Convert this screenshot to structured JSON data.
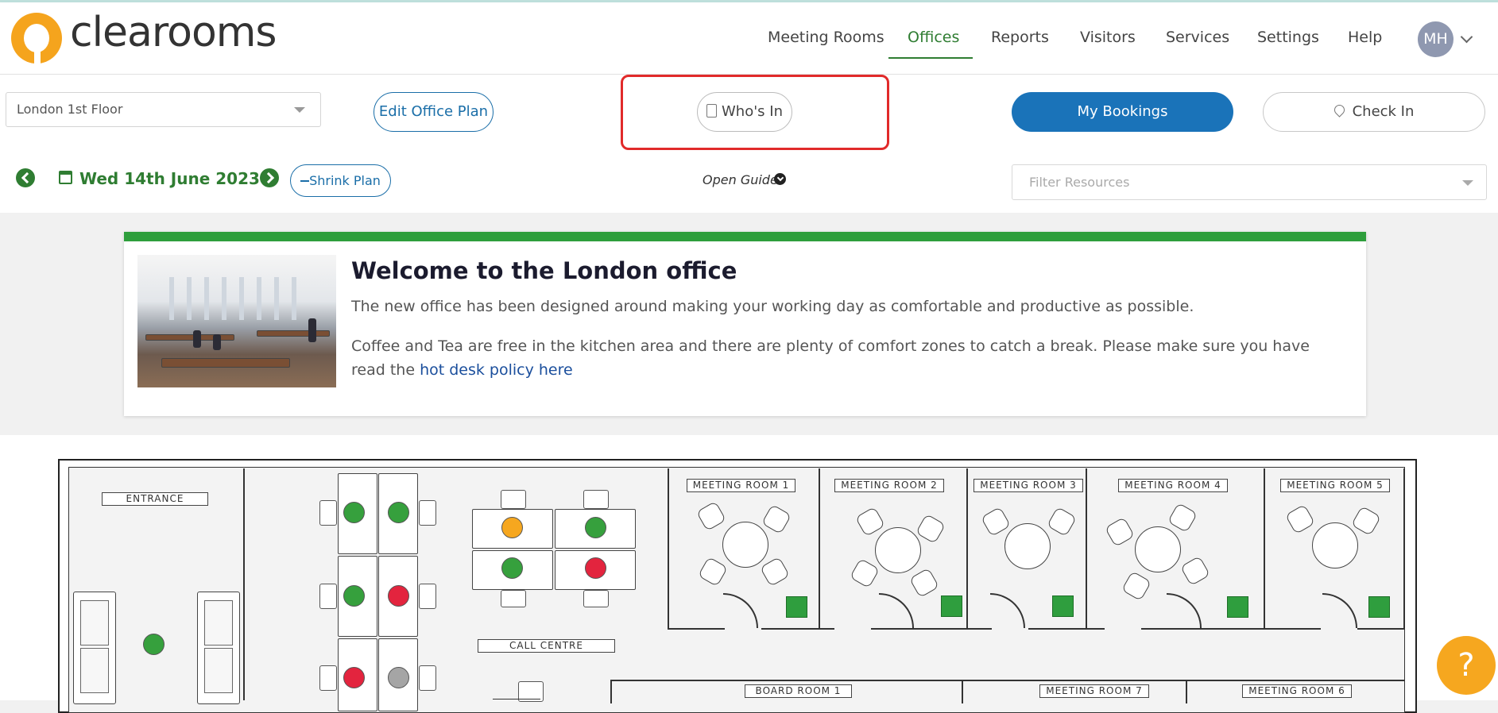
{
  "brand": {
    "name": "clearooms"
  },
  "nav": {
    "items": [
      "Meeting Rooms",
      "Offices",
      "Reports",
      "Visitors",
      "Services",
      "Settings",
      "Help"
    ],
    "active": "Offices",
    "avatar_initials": "MH"
  },
  "toolbar": {
    "location_select": "London 1st Floor",
    "edit_plan_label": "Edit Office Plan",
    "whos_in_label": "Who's In",
    "my_bookings_label": "My Bookings",
    "check_in_label": "Check In",
    "date_label": "Wed 14th June 2023",
    "shrink_plan_label": "Shrink Plan",
    "open_guide_label": "Open Guide",
    "filter_placeholder": "Filter Resources"
  },
  "welcome": {
    "title": "Welcome to the London office",
    "paragraph1": "The new office has been designed around making your working day as comfortable and productive as possible.",
    "paragraph2": "Coffee and Tea are free in the kitchen area and there are plenty of comfort zones to catch a break. Please make sure you have read the ",
    "link_text": "hot desk policy here"
  },
  "floor_plan": {
    "labels": {
      "entrance": "ENTRANCE",
      "call_centre": "CALL CENTRE",
      "board_room_1": "BOARD ROOM 1",
      "meeting_room_1": "MEETING ROOM 1",
      "meeting_room_2": "MEETING ROOM 2",
      "meeting_room_3": "MEETING ROOM 3",
      "meeting_room_4": "MEETING ROOM 4",
      "meeting_room_5": "MEETING ROOM 5",
      "meeting_room_6": "MEETING ROOM 6",
      "meeting_room_7": "MEETING ROOM 7"
    },
    "status_colors": {
      "available": "#36a03d",
      "booked": "#e3243e",
      "partial": "#f6a71f",
      "unavailable": "#a5a5a5"
    }
  },
  "help_button": {
    "label": "?"
  },
  "colors": {
    "accent_green": "#2f7d32",
    "primary_blue": "#1a73b9",
    "highlight_red": "#e12a2a",
    "brand_orange": "#f5a41d"
  }
}
